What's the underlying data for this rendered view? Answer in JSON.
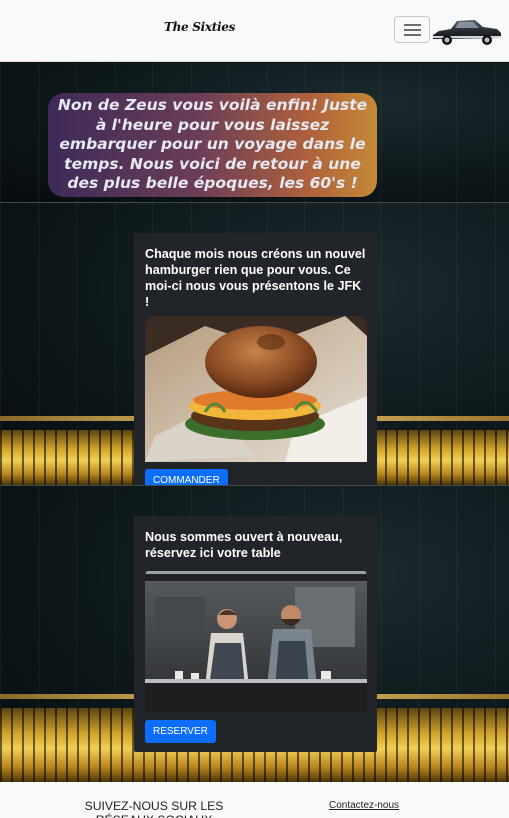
{
  "navbar": {
    "brand": "The Sixties",
    "toggle_icon": "hamburger-menu-icon",
    "logo_icon": "vintage-car-icon"
  },
  "hero": {
    "message": "Non de Zeus vous voilà enfin! Juste à l'heure pour vous laissez embarquer pour un voyage dans le temps. Nous voici de retour à une des plus belle époques, les 60's !"
  },
  "cards": [
    {
      "text": "Chaque mois nous créons un nouvel hamburger rien que pour vous. Ce moi-ci nous vous présentons le JFK !",
      "image_icon": "burger-photo",
      "button": "COMMANDER"
    },
    {
      "text": "Nous sommes ouvert à nouveau, réservez ici votre table",
      "image_icon": "kitchen-chefs-photo",
      "button": "RESERVER"
    }
  ],
  "footer": {
    "social": "SUIVEZ-NOUS SUR LES RÉSEAUX SOCIAUX",
    "contact": "Contactez-nous"
  },
  "colors": {
    "primary_button": "#0d6efd",
    "card_bg": "#212529",
    "navbar_bg": "#f8f9fa"
  }
}
